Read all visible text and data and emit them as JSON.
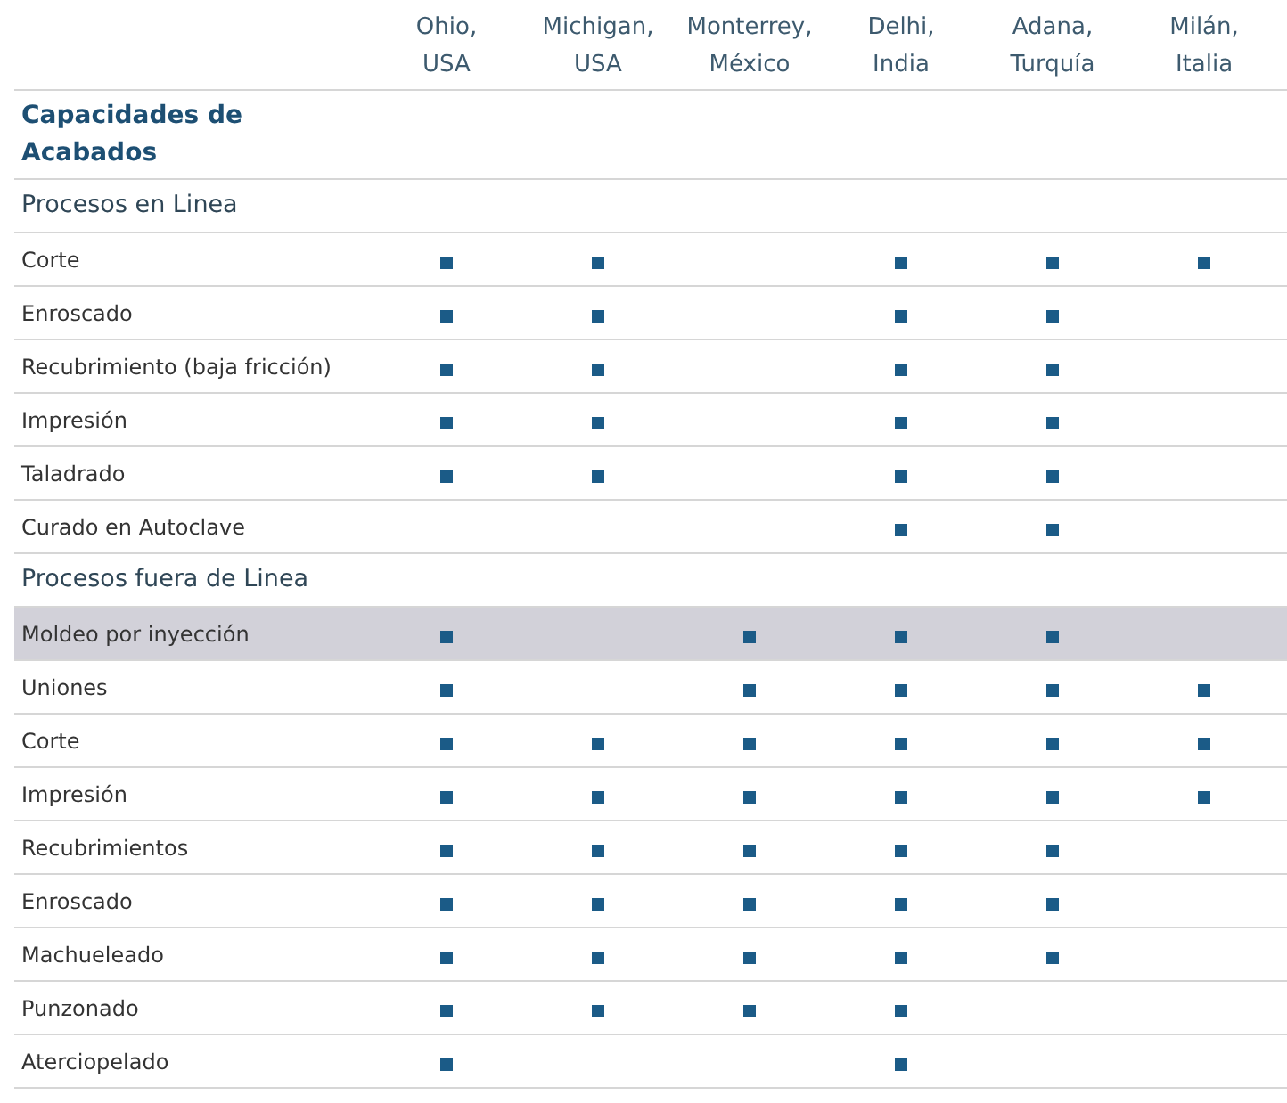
{
  "columns": [
    {
      "lines": [
        "Ohio,",
        "USA"
      ]
    },
    {
      "lines": [
        "Michigan,",
        "USA"
      ]
    },
    {
      "lines": [
        "Monterrey,",
        "México"
      ]
    },
    {
      "lines": [
        "Delhi,",
        "India"
      ]
    },
    {
      "lines": [
        "Adana,",
        "Turquía"
      ]
    },
    {
      "lines": [
        "Milán,",
        "Italia"
      ]
    }
  ],
  "rows": [
    {
      "kind": "title",
      "label": "Capacidades de Acabados"
    },
    {
      "kind": "section",
      "label": "Procesos en Linea"
    },
    {
      "kind": "item",
      "label": "Corte",
      "highlighted": false,
      "marks": [
        true,
        true,
        false,
        true,
        true,
        true
      ]
    },
    {
      "kind": "item",
      "label": "Enroscado",
      "highlighted": false,
      "marks": [
        true,
        true,
        false,
        true,
        true,
        false
      ]
    },
    {
      "kind": "item",
      "label": "Recubrimiento (baja fricción)",
      "highlighted": false,
      "marks": [
        true,
        true,
        false,
        true,
        true,
        false
      ]
    },
    {
      "kind": "item",
      "label": "Impresión",
      "highlighted": false,
      "marks": [
        true,
        true,
        false,
        true,
        true,
        false
      ]
    },
    {
      "kind": "item",
      "label": "Taladrado",
      "highlighted": false,
      "marks": [
        true,
        true,
        false,
        true,
        true,
        false
      ]
    },
    {
      "kind": "item",
      "label": "Curado en Autoclave",
      "highlighted": false,
      "marks": [
        false,
        false,
        false,
        true,
        true,
        false
      ]
    },
    {
      "kind": "section",
      "label": "Procesos fuera de Linea"
    },
    {
      "kind": "item",
      "label": "Moldeo por inyección",
      "highlighted": true,
      "marks": [
        true,
        false,
        true,
        true,
        true,
        false
      ]
    },
    {
      "kind": "item",
      "label": "Uniones",
      "highlighted": false,
      "marks": [
        true,
        false,
        true,
        true,
        true,
        true
      ]
    },
    {
      "kind": "item",
      "label": "Corte",
      "highlighted": false,
      "marks": [
        true,
        true,
        true,
        true,
        true,
        true
      ]
    },
    {
      "kind": "item",
      "label": "Impresión",
      "highlighted": false,
      "marks": [
        true,
        true,
        true,
        true,
        true,
        true
      ]
    },
    {
      "kind": "item",
      "label": "Recubrimientos",
      "highlighted": false,
      "marks": [
        true,
        true,
        true,
        true,
        true,
        false
      ]
    },
    {
      "kind": "item",
      "label": "Enroscado",
      "highlighted": false,
      "marks": [
        true,
        true,
        true,
        true,
        true,
        false
      ]
    },
    {
      "kind": "item",
      "label": "Machueleado",
      "highlighted": false,
      "marks": [
        true,
        true,
        true,
        true,
        true,
        false
      ]
    },
    {
      "kind": "item",
      "label": "Punzonado",
      "highlighted": false,
      "marks": [
        true,
        true,
        true,
        true,
        false,
        false
      ]
    },
    {
      "kind": "item",
      "label": "Aterciopelado",
      "highlighted": false,
      "marks": [
        true,
        false,
        false,
        true,
        false,
        false
      ]
    }
  ]
}
